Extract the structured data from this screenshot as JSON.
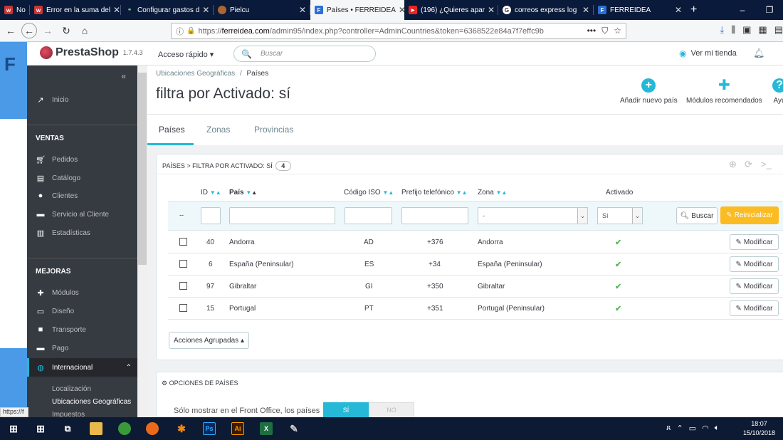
{
  "browser": {
    "tabs": [
      {
        "label": "No",
        "fav": "w"
      },
      {
        "label": "Error en la suma del",
        "fav": "w"
      },
      {
        "label": "Configurar gastos d",
        "fav": "⚭"
      },
      {
        "label": "Pielcu",
        "fav": "●"
      },
      {
        "label": "Países • FERREIDEA",
        "fav": "F"
      },
      {
        "label": "(196) ¿Quieres apar",
        "fav": "▶"
      },
      {
        "label": "correos express log",
        "fav": "G"
      },
      {
        "label": "FERREIDEA",
        "fav": "F"
      }
    ],
    "new_tab": "+",
    "url_prefix": "https://",
    "url_host": "ferreidea.com",
    "url_path": "/admin95/index.php?controller=AdminCountries&token=6368522e84a7f7effc9b",
    "url_more": "•••",
    "status_url": "https://f"
  },
  "header": {
    "logo": "PrestaShop",
    "version": "1.7.4.3",
    "quick_access": "Acceso rápido ▾",
    "search_placeholder": "Buscar",
    "view_store": "Ver mi tienda"
  },
  "sidebar": {
    "home": "Inicio",
    "sec_ventas": "VENTAS",
    "ventas": [
      "Pedidos",
      "Catálogo",
      "Clientes",
      "Servicio al Cliente",
      "Estadísticas"
    ],
    "sec_mejoras": "MEJORAS",
    "mejoras": [
      "Módulos",
      "Diseño",
      "Transporte",
      "Pago"
    ],
    "active": "Internacional",
    "sub": [
      "Localización",
      "Ubicaciones Geográficas",
      "Impuestos"
    ]
  },
  "page": {
    "bc_parent": "Ubicaciones Geográficas",
    "bc_sep": "/",
    "bc_current": "Países",
    "title": "filtra por Activado: sí",
    "toolbar": [
      "Añadir nuevo país",
      "Módulos recomendados",
      "Ayu"
    ],
    "tabs": [
      "Países",
      "Zonas",
      "Provincias"
    ]
  },
  "list": {
    "heading": "PAÍSES > FILTRA POR ACTIVADO: SÍ",
    "count": "4",
    "columns": [
      "ID",
      "País",
      "Código ISO",
      "Prefijo telefónico",
      "Zona",
      "Activado"
    ],
    "filter_dash": "--",
    "zone_filter": "-",
    "active_filter": "Sí",
    "search_btn": "Buscar",
    "reset_btn": "Reinicializar",
    "modify_label": "Modificar",
    "rows": [
      {
        "id": "40",
        "country": "Andorra",
        "iso": "AD",
        "prefix": "+376",
        "zone": "Andorra"
      },
      {
        "id": "6",
        "country": "España (Peninsular)",
        "iso": "ES",
        "prefix": "+34",
        "zone": "España (Peninsular)"
      },
      {
        "id": "97",
        "country": "Gibraltar",
        "iso": "GI",
        "prefix": "+350",
        "zone": "Gibraltar"
      },
      {
        "id": "15",
        "country": "Portugal",
        "iso": "PT",
        "prefix": "+351",
        "zone": "Portugal (Peninsular)"
      }
    ],
    "bulk_actions": "Acciones Agrupadas ▴"
  },
  "options": {
    "heading": "OPCIONES DE PAÍSES",
    "label": "Sólo mostrar en el Front Office, los países",
    "yes": "SÍ",
    "no": "NO"
  },
  "taskbar": {
    "time": "18:07",
    "date": "15/10/2018",
    "apps": [
      "Ps",
      "Ai",
      "X"
    ]
  }
}
